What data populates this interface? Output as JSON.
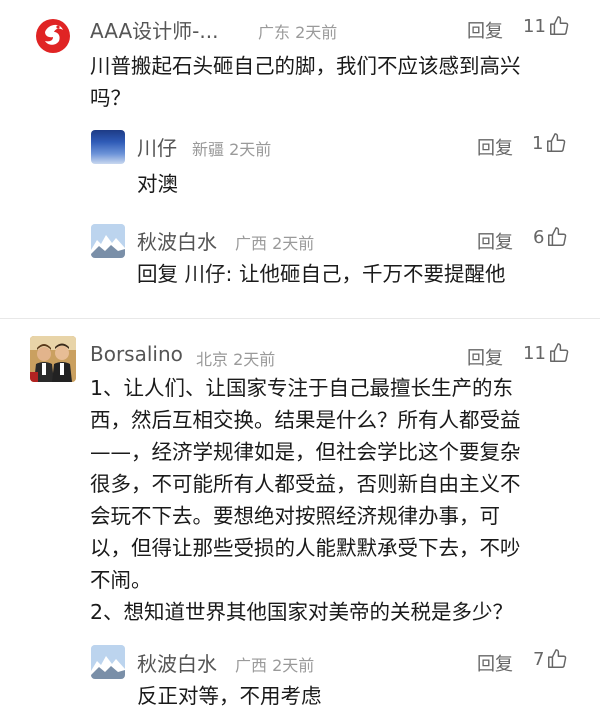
{
  "comments": [
    {
      "user": "AAA设计师-...",
      "location": "广东",
      "time": "2天前",
      "reply_label": "回复",
      "likes": "11",
      "text_lines": [
        "川普搬起石头砸自己的脚，我们不应该感到高兴",
        "吗？"
      ],
      "replies": [
        {
          "user": "川仔",
          "location": "新疆",
          "time": "2天前",
          "reply_label": "回复",
          "likes": "1",
          "text": "对澳"
        },
        {
          "user": "秋波白水",
          "location": "广西",
          "time": "2天前",
          "reply_label": "回复",
          "likes": "6",
          "reply_prefix": "回复",
          "reply_to": "川仔:",
          "text": "让他砸自己，千万不要提醒他"
        }
      ]
    },
    {
      "user": "Borsalino",
      "location": "北京",
      "time": "2天前",
      "reply_label": "回复",
      "likes": "11",
      "text_lines": [
        "1、让人们、让国家专注于自己最擅长生产的东",
        "西，然后互相交换。结果是什么？所有人都受益",
        "——，经济学规律如是，但社会学比这个要复杂",
        "很多，不可能所有人都受益，否则新自由主义不",
        "会玩不下去。要想绝对按照经济规律办事，可",
        "以，但得让那些受损的人能默默承受下去，不吵",
        "不闹。",
        "2、想知道世界其他国家对美帝的关税是多少？"
      ],
      "replies": [
        {
          "user": "秋波白水",
          "location": "广西",
          "time": "2天前",
          "reply_label": "回复",
          "likes": "7",
          "text": "反正对等，不用考虑"
        }
      ]
    }
  ],
  "colors": {
    "meta": "#9a9a9a",
    "name": "#555555",
    "text": "#1a1a1a",
    "divider": "#e8e8e8"
  }
}
